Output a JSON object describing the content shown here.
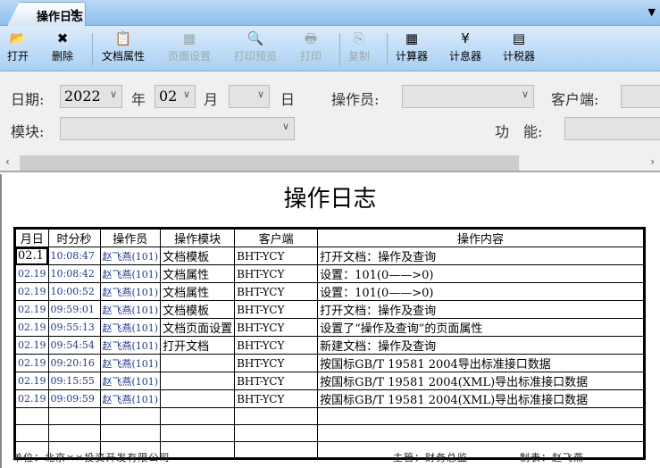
{
  "tab": {
    "title": "操作日志",
    "close": "✕",
    "menu": "▼"
  },
  "toolbar": [
    {
      "label": "打开",
      "icon": "📂",
      "enabled": true
    },
    {
      "label": "删除",
      "icon": "✖",
      "enabled": true
    },
    {
      "label": "文档属性",
      "icon": "📋",
      "enabled": true
    },
    {
      "label": "页面设置",
      "icon": "▦",
      "enabled": false
    },
    {
      "label": "打印预览",
      "icon": "🔍",
      "enabled": false
    },
    {
      "label": "打印",
      "icon": "🖶",
      "enabled": false
    },
    {
      "label": "复制",
      "icon": "⎘",
      "enabled": false
    },
    {
      "label": "计算器",
      "icon": "▦",
      "enabled": true
    },
    {
      "label": "计息器",
      "icon": "¥",
      "enabled": true
    },
    {
      "label": "计税器",
      "icon": "▤",
      "enabled": true
    }
  ],
  "filters": {
    "date_label": "日期:",
    "year": "2022",
    "year_label": "年",
    "month": "02",
    "month_label": "月",
    "day": "",
    "day_label": "日",
    "operator_label": "操作员:",
    "operator": "",
    "client_label": "客户端:",
    "client": "",
    "module_label": "模块:",
    "module": "",
    "function_label": "功　能:",
    "function": ""
  },
  "report": {
    "title": "操作日志",
    "headers": [
      "月日",
      "时分秒",
      "操作员",
      "操作模块",
      "客户端",
      "操作内容"
    ],
    "rows": [
      [
        "02.1",
        "10:08:47",
        "赵飞燕(101)",
        "文档模板",
        "BHT-YCY",
        "打开文档：操作及查询"
      ],
      [
        "02.19",
        "10:08:42",
        "赵飞燕(101)",
        "文档属性",
        "BHT-YCY",
        "设置：101(0——>0)"
      ],
      [
        "02.19",
        "10:00:52",
        "赵飞燕(101)",
        "文档属性",
        "BHT-YCY",
        "设置：101(0——>0)"
      ],
      [
        "02.19",
        "09:59:01",
        "赵飞燕(101)",
        "文档模板",
        "BHT-YCY",
        "打开文档：操作及查询"
      ],
      [
        "02.19",
        "09:55:13",
        "赵飞燕(101)",
        "文档页面设置",
        "BHT-YCY",
        "设置了“操作及查询”的页面属性"
      ],
      [
        "02.19",
        "09:54:54",
        "赵飞燕(101)",
        "打开文档",
        "BHT-YCY",
        "新建文档：操作及查询"
      ],
      [
        "02.19",
        "09:20:16",
        "赵飞燕(101)",
        "",
        "BHT-YCY",
        "按国标GB/T 19581 2004导出标准接口数据"
      ],
      [
        "02.19",
        "09:15:55",
        "赵飞燕(101)",
        "",
        "BHT-YCY",
        "按国标GB/T 19581 2004(XML)导出标准接口数据"
      ],
      [
        "02.19",
        "09:09:59",
        "赵飞燕(101)",
        "",
        "BHT-YCY",
        "按国标GB/T 19581 2004(XML)导出标准接口数据"
      ],
      [
        "",
        "",
        "",
        "",
        "",
        ""
      ],
      [
        "",
        "",
        "",
        "",
        "",
        ""
      ],
      [
        "",
        "",
        "",
        "",
        "",
        ""
      ]
    ],
    "footer": {
      "unit": "单位：北京××投资开发有限公司",
      "supervisor": "主管：财务总监",
      "preparer": "制表：赵飞燕"
    }
  }
}
